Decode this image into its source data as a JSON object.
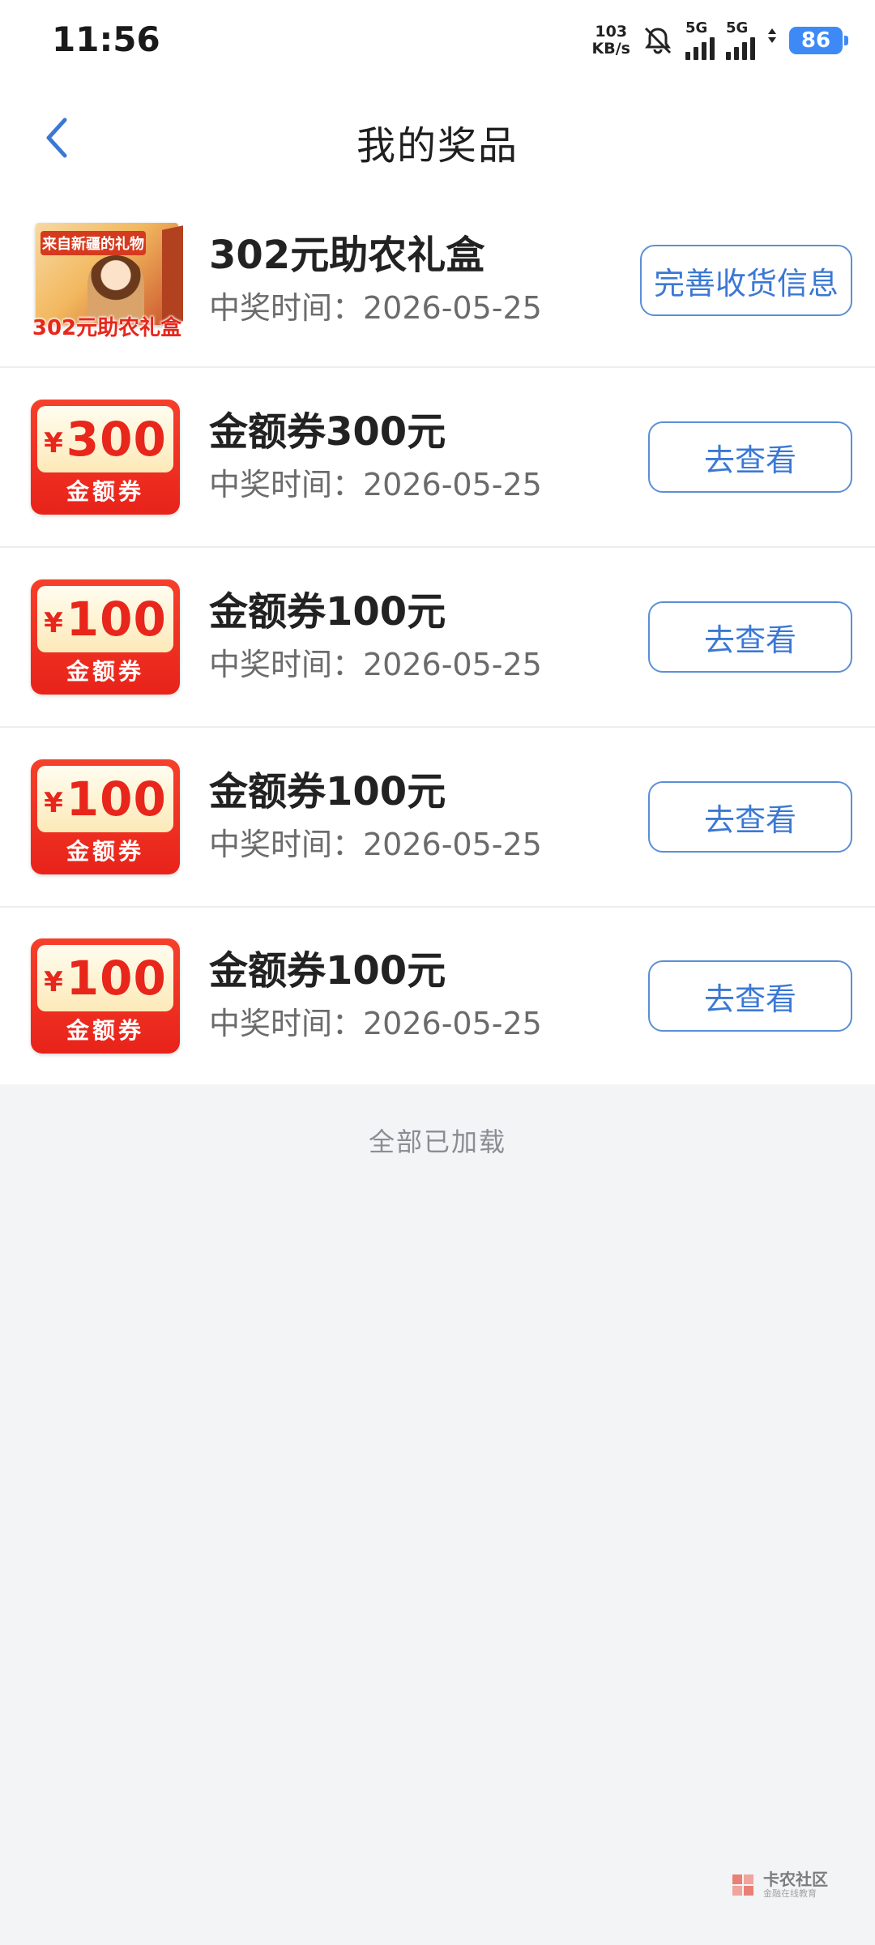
{
  "status_bar": {
    "time": "11:56",
    "net_speed_value": "103",
    "net_speed_unit": "KB/s",
    "sim1_label": "5G",
    "sim2_label": "5G",
    "battery": "86"
  },
  "header": {
    "title": "我的奖品"
  },
  "prizes": [
    {
      "name": "302元助农礼盒",
      "time": "中奖时间：2026-05-25",
      "action": "完善收货信息",
      "thumb_type": "giftbox",
      "box_text": "来自新疆的礼物",
      "box_caption": "302元助农礼盒"
    },
    {
      "name": "金额券300元",
      "time": "中奖时间：2026-05-25",
      "action": "去查看",
      "thumb_type": "coupon",
      "currency": "¥",
      "amount": "300",
      "coupon_label": "金额券"
    },
    {
      "name": "金额券100元",
      "time": "中奖时间：2026-05-25",
      "action": "去查看",
      "thumb_type": "coupon",
      "currency": "¥",
      "amount": "100",
      "coupon_label": "金额券"
    },
    {
      "name": "金额券100元",
      "time": "中奖时间：2026-05-25",
      "action": "去查看",
      "thumb_type": "coupon",
      "currency": "¥",
      "amount": "100",
      "coupon_label": "金额券"
    },
    {
      "name": "金额券100元",
      "time": "中奖时间：2026-05-25",
      "action": "去查看",
      "thumb_type": "coupon",
      "currency": "¥",
      "amount": "100",
      "coupon_label": "金额券"
    }
  ],
  "footer": {
    "loaded_text": "全部已加载"
  },
  "watermark": {
    "title": "卡农社区",
    "subtitle": "金融在线教育"
  },
  "colors": {
    "accent": "#3b78d4",
    "coupon_red": "#e8231a",
    "background": "#f3f4f6"
  }
}
